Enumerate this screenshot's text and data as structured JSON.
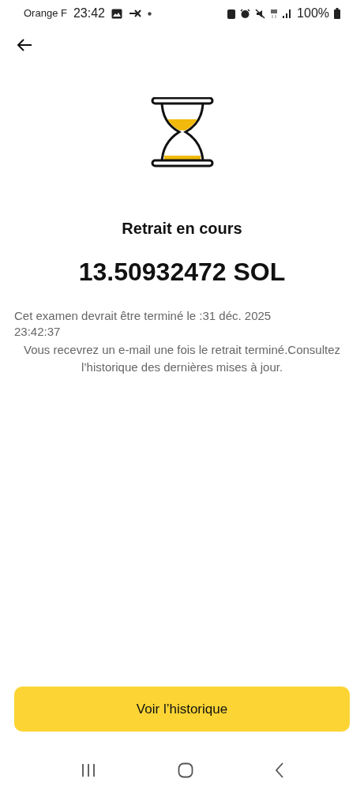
{
  "status_bar": {
    "carrier": "Orange F",
    "time": "23:42",
    "battery": "100%"
  },
  "title": "Retrait en cours",
  "amount": "13.50932472 SOL",
  "estimate": "Cet examen devrait être terminé le :31 déc. 2025 23:42:37",
  "notice": "Vous recevrez un e-mail une fois le retrait terminé.Consultez l’historique des dernières mises à jour.",
  "button": "Voir l’historique"
}
